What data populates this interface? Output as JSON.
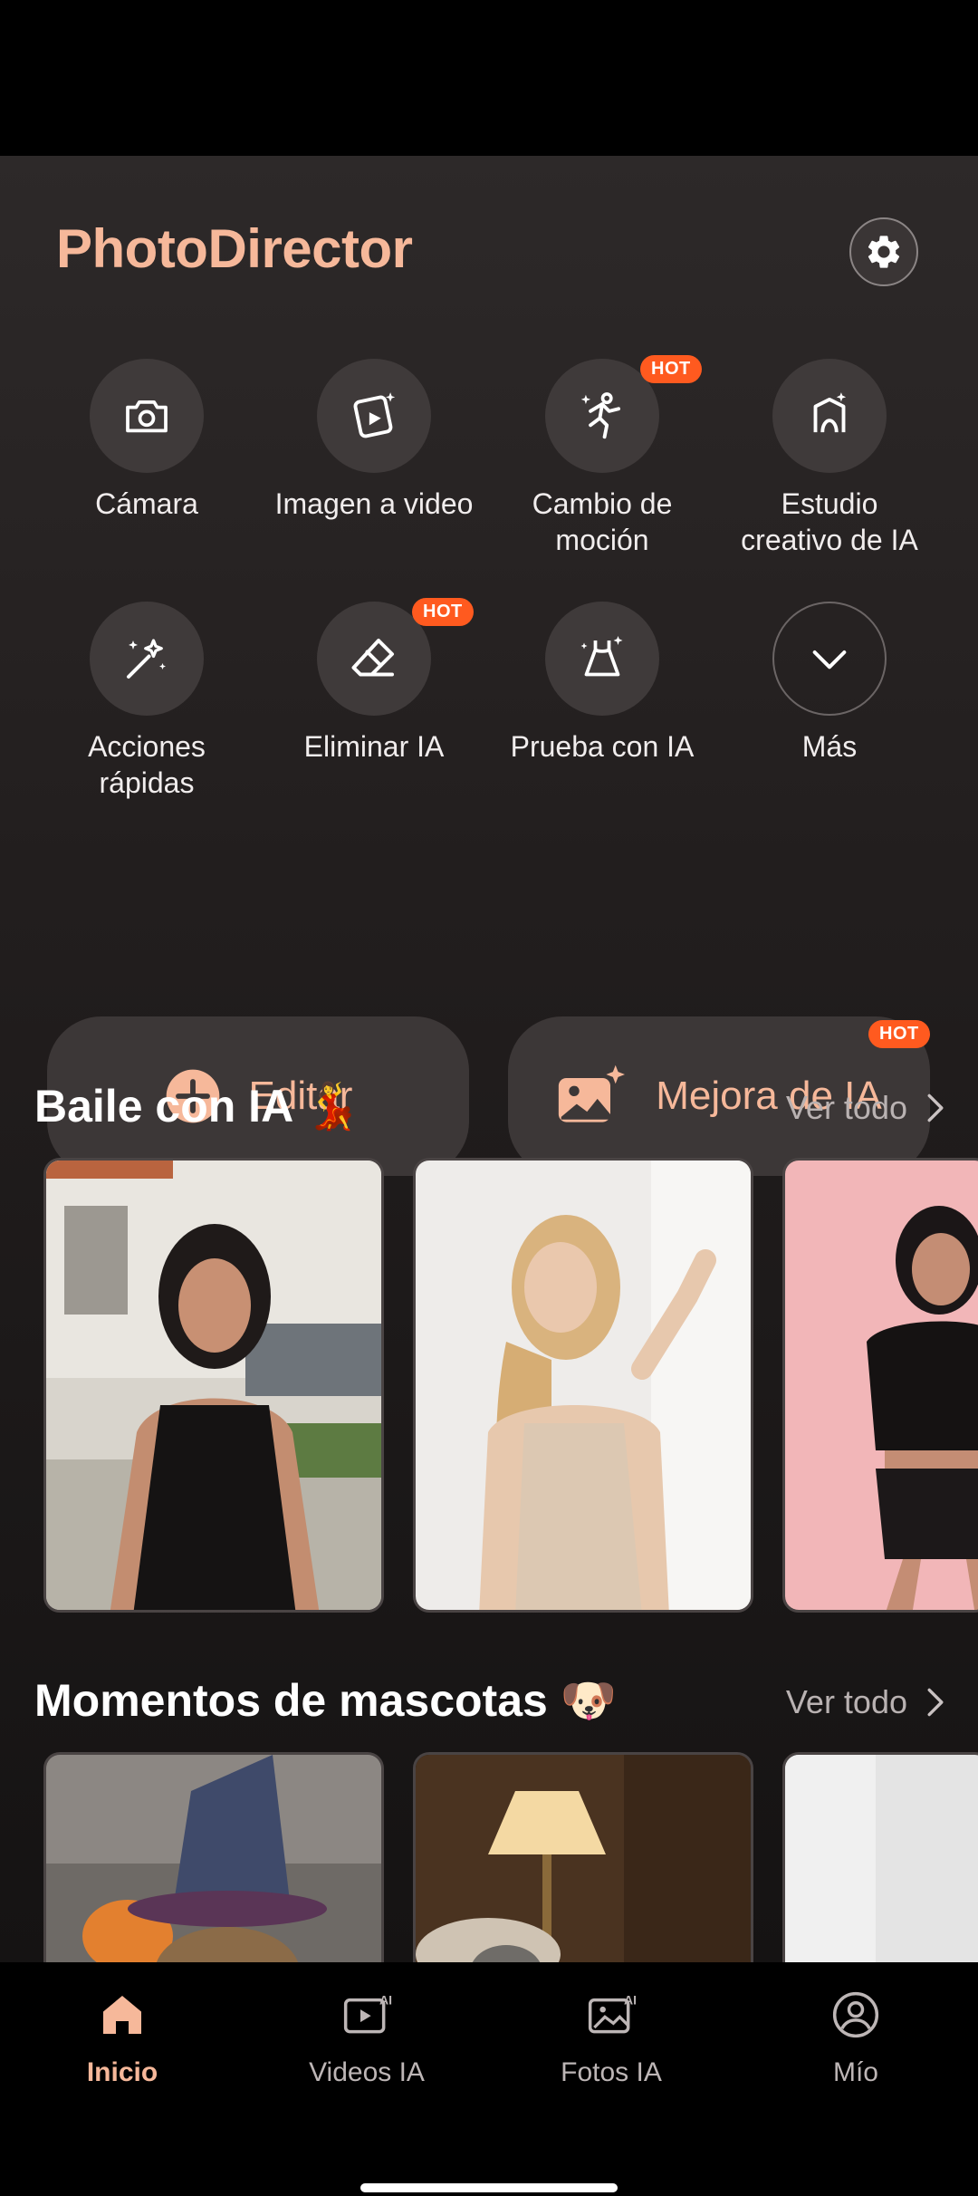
{
  "app": {
    "title": "PhotoDirector"
  },
  "tools": [
    {
      "label": "Cámara",
      "icon": "camera-icon"
    },
    {
      "label": "Imagen a video",
      "icon": "image-to-video-icon"
    },
    {
      "label": "Cambio de moción",
      "icon": "motion-icon",
      "badge": "HOT"
    },
    {
      "label": "Estudio creativo de IA",
      "icon": "ai-studio-icon"
    },
    {
      "label": "Acciones rápidas",
      "icon": "magic-wand-icon"
    },
    {
      "label": "Eliminar IA",
      "icon": "eraser-icon",
      "badge": "HOT"
    },
    {
      "label": "Prueba con IA",
      "icon": "dress-icon"
    },
    {
      "label": "Más",
      "icon": "chevron-down-icon"
    }
  ],
  "actions": {
    "edit_label": "Editar",
    "enhance_label": "Mejora de IA",
    "enhance_badge": "HOT"
  },
  "sections": {
    "dance": {
      "title": "Baile con IA",
      "emoji": "💃",
      "see_all": "Ver todo"
    },
    "pets": {
      "title": "Momentos de mascotas",
      "emoji": "🐶",
      "see_all": "Ver todo"
    }
  },
  "tabs": [
    {
      "label": "Inicio",
      "icon": "home-icon",
      "active": true
    },
    {
      "label": "Videos IA",
      "icon": "ai-video-icon"
    },
    {
      "label": "Fotos IA",
      "icon": "ai-photo-icon"
    },
    {
      "label": "Mío",
      "icon": "profile-icon"
    }
  ],
  "colors": {
    "accent": "#f6b89a",
    "hot": "#ff5a1f",
    "background": "#221e1e"
  }
}
